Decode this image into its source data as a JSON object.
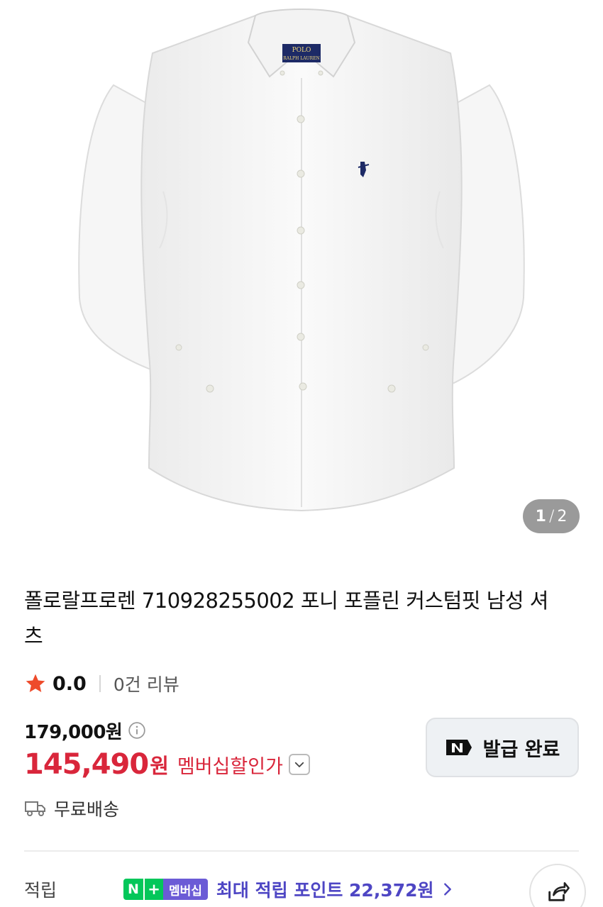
{
  "gallery": {
    "image_alt": "white button-down shirt",
    "counter_current": "1",
    "counter_separator": "/",
    "counter_total": "2",
    "collar_label_line1": "POLO",
    "collar_label_line2": "RALPH LAUREN"
  },
  "product": {
    "title": "폴로랄프로렌 710928255002 포니 포플린 커스텀핏 남성 셔츠"
  },
  "rating": {
    "score": "0.0",
    "reviews": "0건 리뷰"
  },
  "price": {
    "original": "179,000원",
    "sale_value": "145,490",
    "sale_unit": "원",
    "sale_label": "멤버십할인가"
  },
  "coupon": {
    "label": "발급 완료"
  },
  "shipping": {
    "label": "무료배송"
  },
  "points": {
    "label": "적립",
    "badge_n": "N",
    "badge_plus": "+",
    "badge_membership": "멤버십",
    "max_text": "최대 적립 포인트 22,372원"
  },
  "colors": {
    "accent_red": "#d9263b",
    "naver_green": "#03c75a",
    "membership_purple": "#4e46c4"
  },
  "icons": {
    "rating": "star-icon",
    "price_info": "info-icon",
    "dropdown": "chevron-down-icon",
    "coupon": "naver-n-icon",
    "shipping": "truck-icon",
    "points_more": "chevron-right-icon",
    "share": "share-icon"
  }
}
